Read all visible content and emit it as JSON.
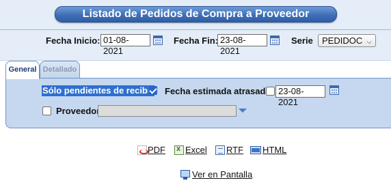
{
  "title": "Listado de Pedidos de Compra a Proveedor",
  "filters": {
    "fecha_inicio_label": "Fecha Inicio:",
    "fecha_inicio_value": "01-08-2021",
    "fecha_fin_label": "Fecha Fin:",
    "fecha_fin_value": "23-08-2021",
    "serie_label": "Serie",
    "serie_value": "PEDIDOC"
  },
  "tabs": [
    {
      "label": "General",
      "active": true
    },
    {
      "label": "Detallado",
      "active": false
    }
  ],
  "general": {
    "pendientes_label": "Sólo pendientes de recibir",
    "pendientes_checked": true,
    "fecha_atrasada_label": "Fecha estimada atrasada",
    "fecha_atrasada_checked": false,
    "fecha_atrasada_value": "23-08-2021",
    "proveedor_label": "Proveedor",
    "proveedor_checked": false,
    "proveedor_value": ""
  },
  "exports": {
    "pdf": "PDF",
    "excel": "Excel",
    "rtf": "RTF",
    "html": "HTML",
    "screen": "Ver en Pantalla"
  },
  "colors": {
    "title_bg": "#3f6fb6",
    "panel_bg": "#c6d8ef",
    "header_bg": "#e4edf8",
    "selection": "#2e6fd0"
  }
}
